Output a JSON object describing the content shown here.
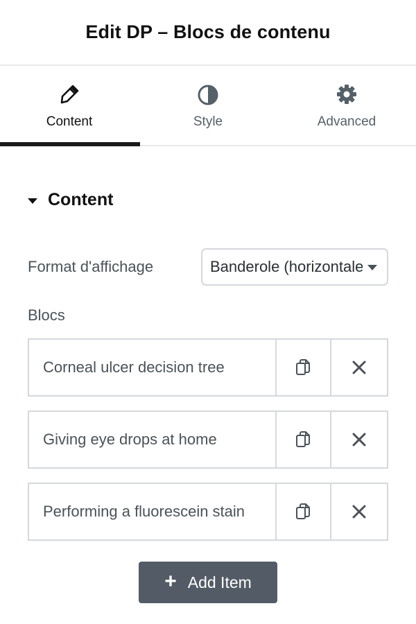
{
  "header": {
    "title": "Edit DP – Blocs de contenu"
  },
  "tabs": [
    {
      "label": "Content",
      "icon": "pencil-icon",
      "active": true
    },
    {
      "label": "Style",
      "icon": "half-circle-icon",
      "active": false
    },
    {
      "label": "Advanced",
      "icon": "gear-icon",
      "active": false
    }
  ],
  "section": {
    "title": "Content"
  },
  "format_field": {
    "label": "Format d'affichage",
    "value": "Banderole (horizontale)"
  },
  "blocs": {
    "label": "Blocs",
    "items": [
      {
        "title": "Corneal ulcer decision tree"
      },
      {
        "title": "Giving eye drops at home"
      },
      {
        "title": "Performing a fluorescein stain"
      }
    ]
  },
  "add_button": {
    "label": "Add Item"
  },
  "colors": {
    "accent": "#1a1a1a",
    "button_bg": "#535c66",
    "border": "#d5d8dc",
    "text_muted": "#4a5258"
  }
}
